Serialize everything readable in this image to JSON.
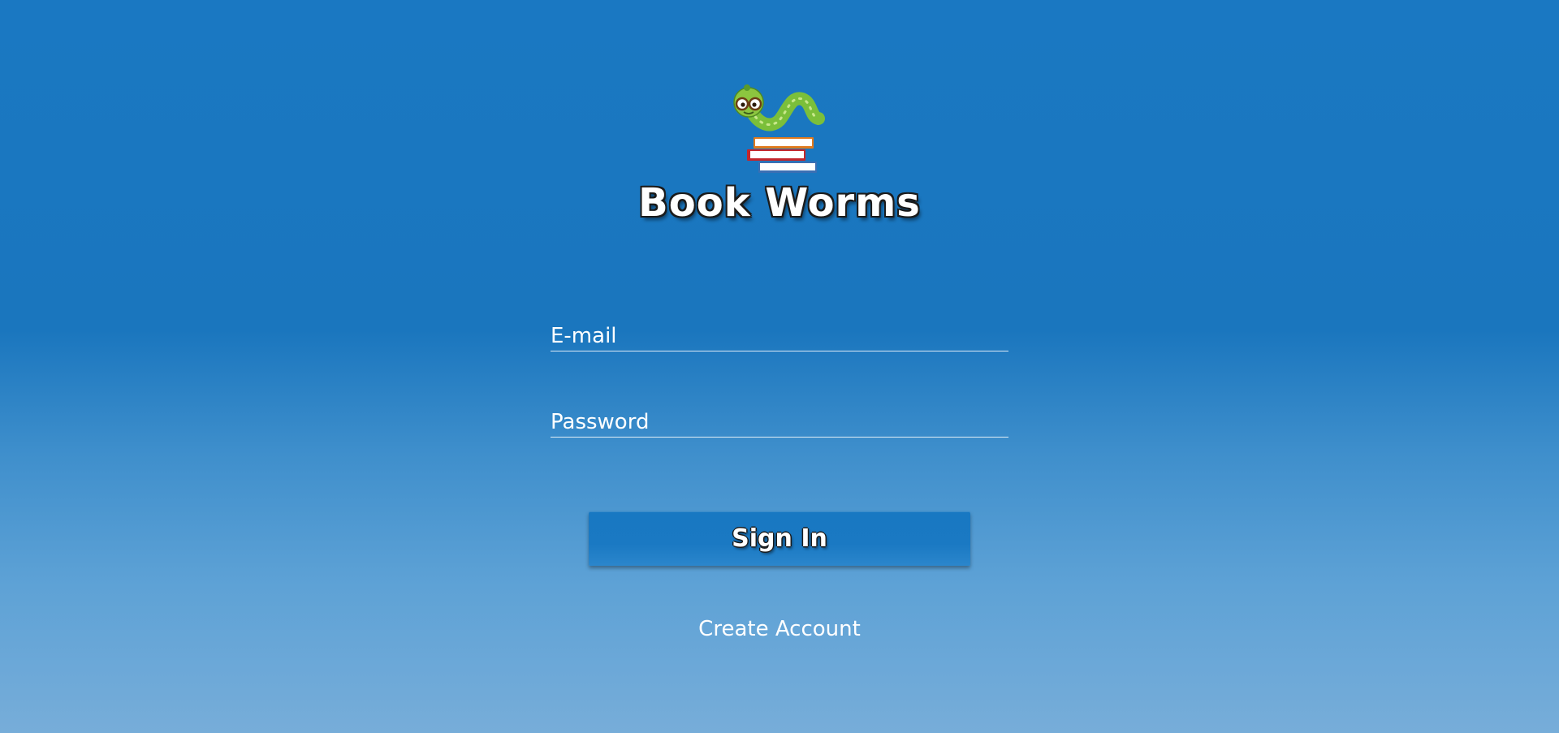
{
  "app": {
    "title": "Book Worms",
    "logo_icon": "bookworm-on-books-icon"
  },
  "form": {
    "email_placeholder": "E-mail",
    "email_value": "",
    "password_placeholder": "Password",
    "password_value": "",
    "signin_label": "Sign In",
    "create_account_label": "Create Account"
  },
  "colors": {
    "background_top": "#1a78c2",
    "background_bottom": "#77add9",
    "button": "#1878c2",
    "text": "#ffffff"
  }
}
